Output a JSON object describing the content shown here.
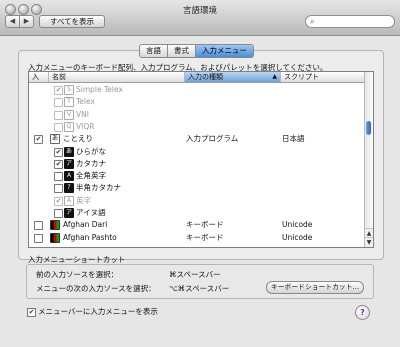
{
  "window": {
    "title": "言語環境"
  },
  "toolbar": {
    "back_icon": "◀",
    "forward_icon": "▶",
    "show_all_label": "すべてを表示",
    "search_icon": "⌕"
  },
  "tabs": [
    {
      "label": "言語",
      "active": false
    },
    {
      "label": "書式",
      "active": false
    },
    {
      "label": "入力メニュー",
      "active": true
    }
  ],
  "description": "入力メニューのキーボード配列、入力プログラム、およびパレットを選択してください。",
  "table": {
    "headers": {
      "enabled": "入",
      "name": "名前",
      "type": "入力の種類",
      "script": "スクリプト",
      "sort_indicator": "▲"
    },
    "rows": [
      {
        "enabled": true,
        "dim": true,
        "icon": "S",
        "name": "Simple Telex",
        "type": "",
        "script": ""
      },
      {
        "enabled": false,
        "dim": true,
        "icon": "T",
        "name": "Telex",
        "type": "",
        "script": ""
      },
      {
        "enabled": false,
        "dim": true,
        "icon": "V",
        "name": "VNI",
        "type": "",
        "script": ""
      },
      {
        "enabled": false,
        "dim": true,
        "icon": "Q",
        "name": "VIQR",
        "type": "",
        "script": ""
      },
      {
        "enabled": true,
        "dim": false,
        "icon": "あ",
        "name": "ことえり",
        "type": "入力プログラム",
        "script": "日本語"
      },
      {
        "enabled": true,
        "dim": false,
        "icon": "あ",
        "name": "ひらがな",
        "type": "",
        "script": ""
      },
      {
        "enabled": true,
        "dim": false,
        "icon": "ア",
        "name": "カタカナ",
        "type": "",
        "script": ""
      },
      {
        "enabled": false,
        "dim": false,
        "icon": "A",
        "name": "全角英字",
        "type": "",
        "script": ""
      },
      {
        "enabled": false,
        "dim": false,
        "icon": "ｱ",
        "name": "半角カタカナ",
        "type": "",
        "script": ""
      },
      {
        "enabled": true,
        "dim": true,
        "icon": "A",
        "name": "英字",
        "type": "",
        "script": ""
      },
      {
        "enabled": false,
        "dim": false,
        "icon": "ア",
        "name": "アイヌ語",
        "type": "",
        "script": ""
      },
      {
        "enabled": false,
        "dim": false,
        "icon": "flag",
        "name": "Afghan Dari",
        "type": "キーボード",
        "script": "Unicode"
      },
      {
        "enabled": false,
        "dim": false,
        "icon": "flag",
        "name": "Afghan Pashto",
        "type": "キーボード",
        "script": "Unicode"
      }
    ]
  },
  "shortcuts": {
    "title": "入力メニューショートカット",
    "prev_label": "前の入力ソースを選択：",
    "prev_value": "⌘スペースバー",
    "next_label": "メニューの次の入力ソースを選択：",
    "next_value": "⌥⌘スペースバー",
    "button_label": "キーボードショートカット..."
  },
  "menubar": {
    "checked": true,
    "label": "メニューバーに入力メニューを表示"
  },
  "help": {
    "label": "?"
  },
  "checkmark": "✔",
  "scroll": {
    "up": "▲",
    "down": "▼"
  }
}
